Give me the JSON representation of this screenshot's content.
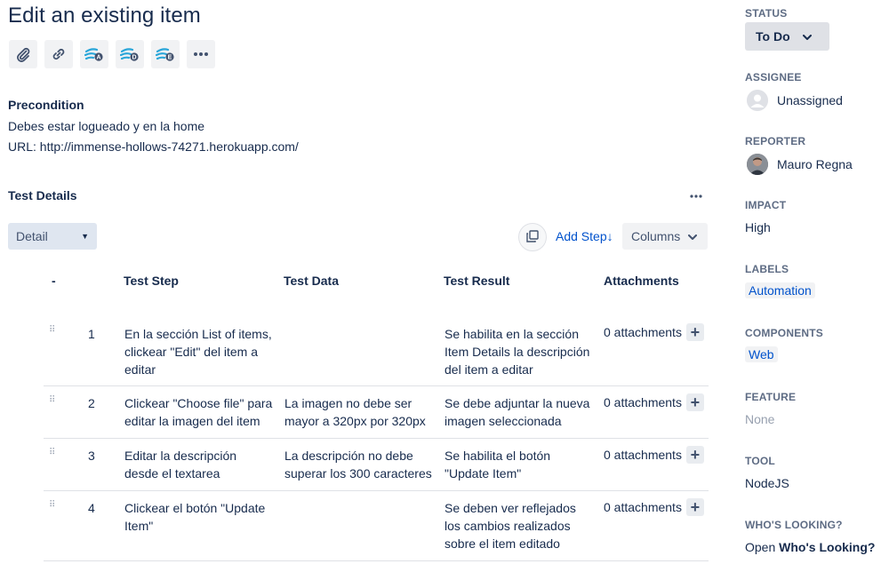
{
  "page": {
    "title": "Edit an existing item"
  },
  "toolbar": {
    "icons": [
      "attachment-icon",
      "link-icon",
      "xray-a-icon",
      "xray-d-icon",
      "xray-e-icon",
      "more-icon"
    ],
    "icon_letters": [
      "A",
      "D",
      "E"
    ]
  },
  "precondition": {
    "heading": "Precondition",
    "line1": "Debes estar logueado y en la home",
    "line2": "URL: http://immense-hollows-74271.herokuapp.com/"
  },
  "test_details": {
    "heading": "Test Details",
    "view_select": "Detail",
    "add_step": "Add Step↓",
    "columns": "Columns",
    "headers": {
      "index": "-",
      "step": "Test Step",
      "data": "Test Data",
      "result": "Test Result",
      "attachments": "Attachments"
    },
    "rows": [
      {
        "num": "1",
        "step": [
          "En la sección List of items,",
          "clickear \"Edit\" del item a",
          "editar"
        ],
        "data": [],
        "result": [
          "Se habilita en la sección",
          "Item Details la descripción",
          "del item a editar"
        ],
        "attachments": "0 attachments"
      },
      {
        "num": "2",
        "step": [
          "Clickear \"Choose file\" para",
          "editar la imagen del item"
        ],
        "data": [
          "La imagen no debe ser",
          "mayor a 320px por 320px"
        ],
        "result": [
          "Se debe adjuntar la nueva",
          "imagen seleccionada"
        ],
        "attachments": "0 attachments"
      },
      {
        "num": "3",
        "step": [
          "Editar la descripción",
          "desde el textarea"
        ],
        "data": [
          "La descripción no debe",
          "superar los 300 caracteres"
        ],
        "result": [
          "Se habilita el botón",
          "\"Update Item\""
        ],
        "attachments": "0 attachments"
      },
      {
        "num": "4",
        "step": [
          "Clickear el botón \"Update",
          "Item\""
        ],
        "data": [],
        "result": [
          "Se deben ver reflejados",
          "los cambios realizados",
          "sobre el item editado"
        ],
        "attachments": "0 attachments"
      }
    ]
  },
  "sidebar": {
    "status_label": "STATUS",
    "status_value": "To Do",
    "assignee_label": "ASSIGNEE",
    "assignee_value": "Unassigned",
    "reporter_label": "REPORTER",
    "reporter_value": "Mauro Regna",
    "impact_label": "IMPACT",
    "impact_value": "High",
    "labels_label": "LABELS",
    "labels_value": "Automation",
    "components_label": "COMPONENTS",
    "components_value": "Web",
    "feature_label": "FEATURE",
    "feature_value": "None",
    "tool_label": "TOOL",
    "tool_value": "NodeJS",
    "whos_looking_label": "WHO'S LOOKING?",
    "whos_looking_prefix": "Open",
    "whos_looking_link": "Who's Looking?"
  },
  "colors": {
    "text": "#172b4d",
    "link": "#0052cc",
    "muted": "#5e6c84",
    "xray_accent": "#2aa6d9"
  }
}
